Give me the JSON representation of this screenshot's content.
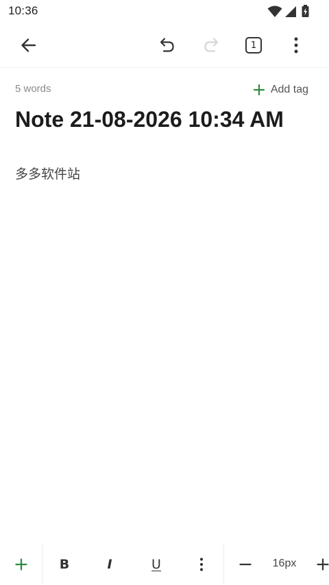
{
  "status_bar": {
    "time": "10:36",
    "icons": [
      "wifi-icon",
      "signal-icon",
      "battery-charging-icon"
    ]
  },
  "toolbar": {
    "buttons": [
      "back-arrow-icon",
      "undo-icon",
      "redo-icon",
      "pages-icon",
      "more-vert-icon"
    ],
    "redo_enabled": false,
    "page_count": "1"
  },
  "note": {
    "word_count": "5 words",
    "add_tag_label": "Add tag",
    "title": "Note 21-08-2026 10:34 AM",
    "body": "多多软件站"
  },
  "format_bar": {
    "add_icon": "plus-icon",
    "bold": "B",
    "italic": "I",
    "underline": "U",
    "more_icon": "more-vert-icon",
    "decrease_icon": "minus-icon",
    "font_size": "16px",
    "increase_icon": "plus-icon"
  },
  "colors": {
    "accent": "#2e8b3d",
    "icon": "#333333",
    "icon_disabled": "#d6d6d6",
    "muted_text": "#8a8a8a",
    "divider": "#ececec"
  }
}
